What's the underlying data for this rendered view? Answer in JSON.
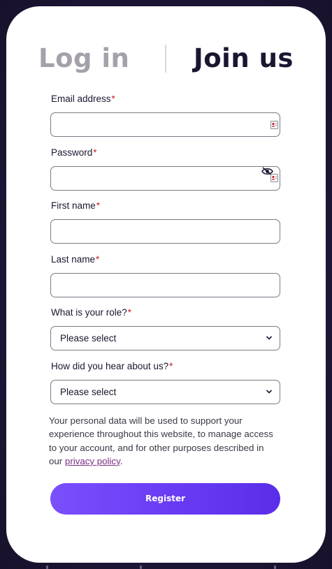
{
  "tabs": {
    "login_label": "Log in",
    "join_label": "Join us"
  },
  "form": {
    "email": {
      "label": "Email address",
      "required_mark": "*",
      "value": ""
    },
    "password": {
      "label": "Password",
      "required_mark": "*",
      "value": ""
    },
    "first_name": {
      "label": "First name",
      "required_mark": "*",
      "value": ""
    },
    "last_name": {
      "label": "Last name",
      "required_mark": "*",
      "value": ""
    },
    "role": {
      "label": "What is your role?",
      "required_mark": "*",
      "selected": "Please select"
    },
    "source": {
      "label": "How did you hear about us?",
      "required_mark": "*",
      "selected": "Please select"
    }
  },
  "consent": {
    "text": "Your personal data will be used to support your experience throughout this website, to manage access to your account, and for other purposes described in our ",
    "link_label": "privacy policy",
    "trailing": "."
  },
  "register_label": "Register",
  "colors": {
    "accent": "#6a3df5",
    "required": "#c2202e",
    "link": "#7a2d82",
    "background": "#221a3d"
  },
  "icons": {
    "autofill": "contact-card-icon",
    "password_visibility": "eye-slash-icon",
    "select_arrow": "chevron-down-icon"
  }
}
